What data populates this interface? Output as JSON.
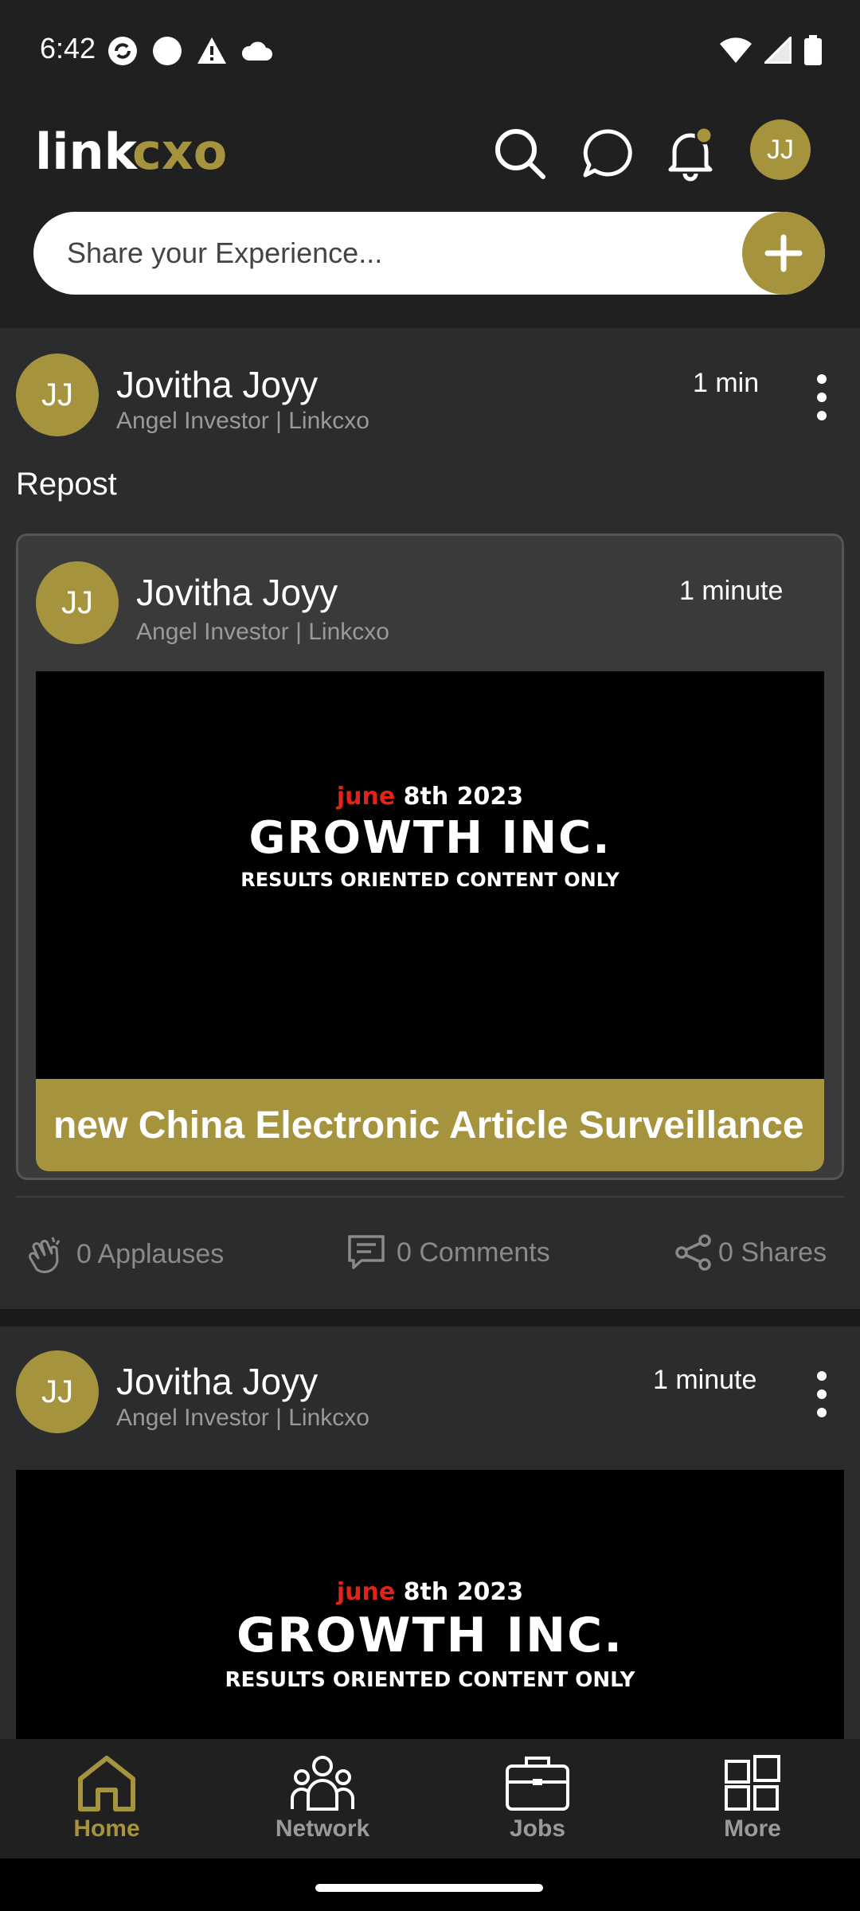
{
  "status_bar": {
    "time": "6:42"
  },
  "header": {
    "logo_text_link": "link",
    "logo_text_cxo": "cxo",
    "avatar_initials": "JJ"
  },
  "composer": {
    "placeholder": "Share your Experience..."
  },
  "posts": [
    {
      "avatar": "JJ",
      "author": "Jovitha Joyy",
      "subtitle": "Angel Investor | Linkcxo",
      "time": "1 min",
      "label": "Repost",
      "repost": {
        "avatar": "JJ",
        "author": "Jovitha Joyy",
        "subtitle": "Angel Investor | Linkcxo",
        "time": "1 minute",
        "banner": {
          "date_highlight": "june",
          "date_rest": "8th 2023",
          "title": "GROWTH INC.",
          "tagline": "RESULTS ORIENTED CONTENT ONLY"
        },
        "article_title": "new China Electronic Article Surveillance"
      },
      "actions": {
        "applause": "0 Applauses",
        "comments": "0 Comments",
        "shares": "0 Shares"
      }
    },
    {
      "avatar": "JJ",
      "author": "Jovitha Joyy",
      "subtitle": "Angel Investor | Linkcxo",
      "time": "1 minute",
      "banner": {
        "date_highlight": "june",
        "date_rest": "8th 2023",
        "title": "GROWTH INC.",
        "tagline": "RESULTS ORIENTED CONTENT ONLY"
      }
    }
  ],
  "bottom_nav": [
    {
      "label": "Home",
      "icon": "home-icon",
      "active": true
    },
    {
      "label": "Network",
      "icon": "network-icon",
      "active": false
    },
    {
      "label": "Jobs",
      "icon": "briefcase-icon",
      "active": false
    },
    {
      "label": "More",
      "icon": "grid-icon",
      "active": false
    }
  ],
  "colors": {
    "accent": "#a6933d",
    "background": "#202020",
    "card": "#2b2c2d",
    "muted_text": "#9a9a9a"
  }
}
